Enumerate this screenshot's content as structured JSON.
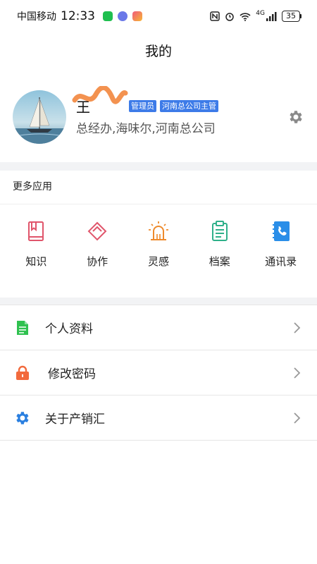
{
  "status_bar": {
    "carrier": "中国移动",
    "time": "12:33",
    "network": "4G",
    "battery": "35"
  },
  "header": {
    "title": "我的"
  },
  "profile": {
    "name": "王",
    "badges": [
      "管理员",
      "河南总公司主管"
    ],
    "org": "总经办,海味尔,河南总公司"
  },
  "more_apps": {
    "title": "更多应用",
    "items": [
      {
        "label": "知识",
        "icon": "book-icon",
        "color": "#e0556b"
      },
      {
        "label": "协作",
        "icon": "diamond-heart-icon",
        "color": "#e0556b"
      },
      {
        "label": "灵感",
        "icon": "lightbulb-icon",
        "color": "#ee8a2c"
      },
      {
        "label": "档案",
        "icon": "clipboard-icon",
        "color": "#2fb08a"
      },
      {
        "label": "通讯录",
        "icon": "contacts-phone-icon",
        "color": "#2a8ee8"
      }
    ]
  },
  "menu": [
    {
      "label": "个人资料",
      "icon": "document-icon",
      "color": "#2fc14f"
    },
    {
      "label": "修改密码",
      "icon": "lock-icon",
      "color": "#f26a3d"
    },
    {
      "label": "关于产销汇",
      "icon": "gear-icon",
      "color": "#2a7fe0"
    }
  ]
}
